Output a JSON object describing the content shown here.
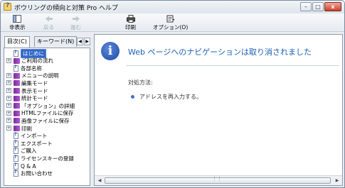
{
  "window": {
    "title": "ボウリングの傾向と対策 Pro ヘルプ",
    "buttons": {
      "minimize": "–",
      "maximize": "□",
      "close": "x"
    }
  },
  "toolbar": {
    "hide": "非表示",
    "back": "戻る",
    "forward": "進む",
    "print": "印刷",
    "options": "オプション(O)"
  },
  "tabs": {
    "contents": "目次(C)",
    "keyword": "キーワード(N)",
    "arrow_left": "◀",
    "arrow_right": "▶"
  },
  "tree": [
    {
      "label": "はじめに",
      "kind": "page",
      "selected": true,
      "expandable": false
    },
    {
      "label": "ご利用の流れ",
      "kind": "book",
      "selected": false,
      "expandable": true
    },
    {
      "label": "各部名称",
      "kind": "page",
      "selected": false,
      "expandable": false
    },
    {
      "label": "メニューの説明",
      "kind": "book",
      "selected": false,
      "expandable": true
    },
    {
      "label": "編集モード",
      "kind": "book",
      "selected": false,
      "expandable": true
    },
    {
      "label": "表示モード",
      "kind": "book",
      "selected": false,
      "expandable": true
    },
    {
      "label": "統計モード",
      "kind": "book",
      "selected": false,
      "expandable": true
    },
    {
      "label": "「オプション」の詳細",
      "kind": "book",
      "selected": false,
      "expandable": true
    },
    {
      "label": "HTMLファイルに保存",
      "kind": "book",
      "selected": false,
      "expandable": true
    },
    {
      "label": "画像ファイルに保存",
      "kind": "book",
      "selected": false,
      "expandable": true
    },
    {
      "label": "印刷",
      "kind": "book",
      "selected": false,
      "expandable": true
    },
    {
      "label": "インポート",
      "kind": "page",
      "selected": false,
      "expandable": false
    },
    {
      "label": "エクスポート",
      "kind": "page",
      "selected": false,
      "expandable": false
    },
    {
      "label": "ご購入",
      "kind": "page",
      "selected": false,
      "expandable": false
    },
    {
      "label": "ライセンスキーの登録",
      "kind": "page",
      "selected": false,
      "expandable": false
    },
    {
      "label": "Q & A",
      "kind": "page",
      "selected": false,
      "expandable": false
    },
    {
      "label": "お問い合わせ",
      "kind": "page",
      "selected": false,
      "expandable": false
    }
  ],
  "content": {
    "heading": "Web ページへのナビゲーションは取り消されました",
    "remedy_label": "対処方法:",
    "bullets": [
      "アドレスを再入力する。"
    ]
  },
  "colors": {
    "accent": "#1b5fb0",
    "selection": "#3067c8",
    "book": "#8a3aaa"
  },
  "icons": {
    "hide": "hide-pane-icon",
    "back": "back-arrow-icon",
    "forward": "forward-arrow-icon",
    "print": "printer-icon",
    "options": "options-icon",
    "info": "info-icon"
  }
}
